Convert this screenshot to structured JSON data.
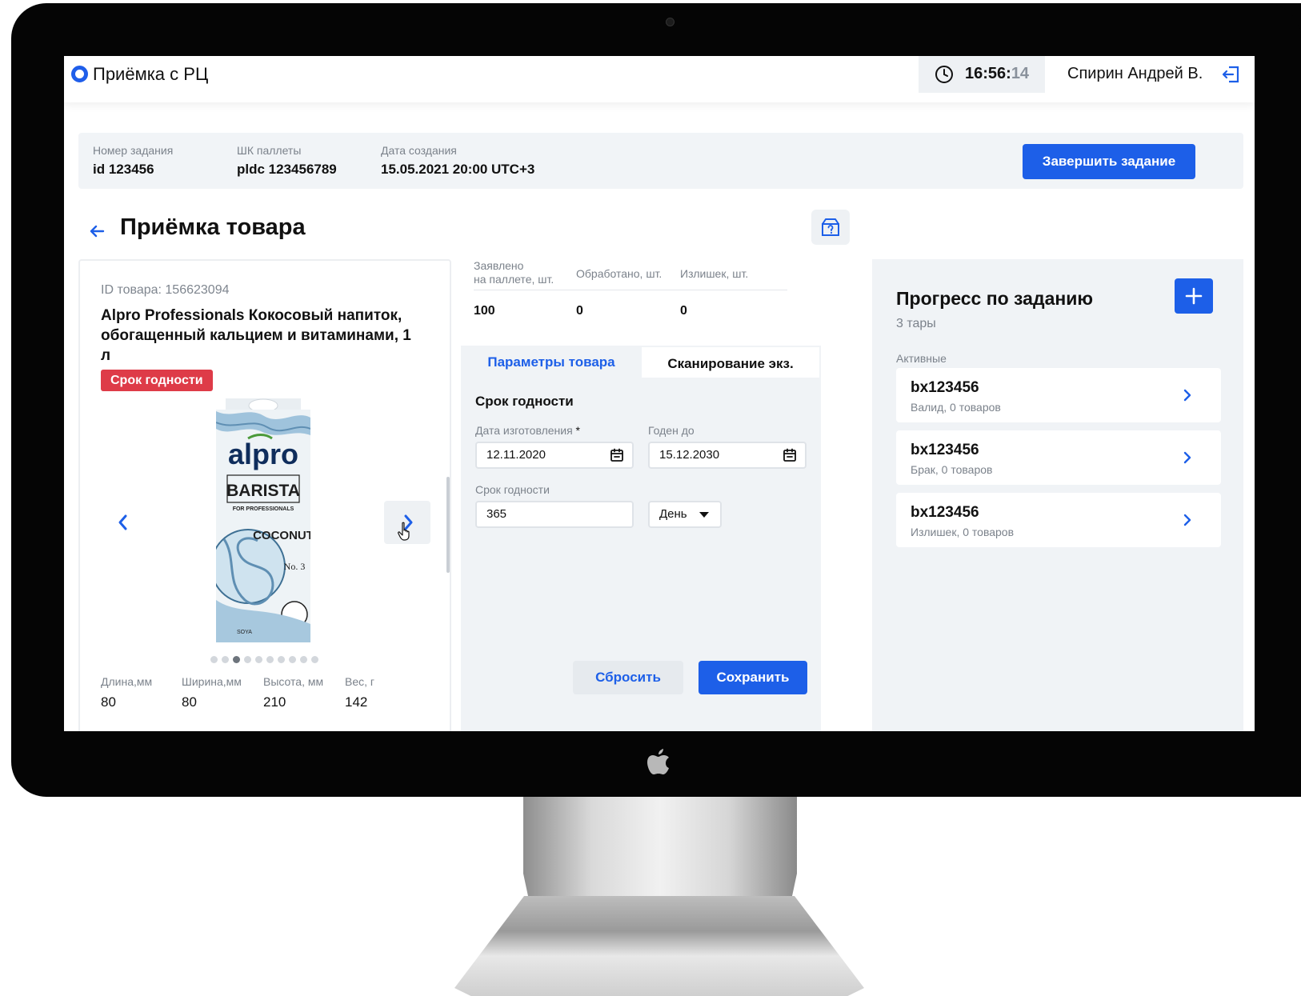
{
  "header": {
    "app_title": "Приёмка с РЦ",
    "clock_main": "16:56:",
    "clock_seconds": "14",
    "user_name": "Спирин Андрей В."
  },
  "task": {
    "number_label": "Номер задания",
    "number_value": "id 123456",
    "pallet_label": "ШК паллеты",
    "pallet_value": "pldc 123456789",
    "created_label": "Дата создания",
    "created_value": "15.05.2021 20:00 UTC+3",
    "finish_button": "Завершить задание"
  },
  "page": {
    "title": "Приёмка товара"
  },
  "product": {
    "id_text": "ID товара: 156623094",
    "name": "Alpro Professionals Кокосовый напиток, обогащенный кальцием и витаминами, 1 л",
    "badge": "Срок годности",
    "carousel_total": 10,
    "carousel_active_index": 3,
    "dimensions": [
      {
        "label": "Длина,мм",
        "value": "80"
      },
      {
        "label": "Ширина,мм",
        "value": "80"
      },
      {
        "label": "Высота, мм",
        "value": "210"
      },
      {
        "label": "Вес, г",
        "value": "142"
      }
    ]
  },
  "stats": {
    "declared_label_1": "Заявлено",
    "declared_label_2": "на паллете, шт.",
    "processed_label": "Обработано, шт.",
    "surplus_label": "Излишек, шт.",
    "declared_value": "100",
    "processed_value": "0",
    "surplus_value": "0"
  },
  "form": {
    "tab_params": "Параметры товара",
    "tab_scan": "Сканирование экз.",
    "section_title": "Срок годности",
    "manufacture_label": "Дата изготовления",
    "required_mark": "*",
    "manufacture_value": "12.11.2020",
    "expiry_label": "Годен до",
    "expiry_value": "15.12.2030",
    "shelf_life_label": "Срок годности",
    "shelf_life_value": "365",
    "unit_value": "День",
    "reset_button": "Сбросить",
    "save_button": "Сохранить"
  },
  "progress": {
    "title": "Прогресс по заданию",
    "subtitle": "3 тары",
    "section_label": "Активные",
    "boxes": [
      {
        "id": "bx123456",
        "meta": "Валид, 0 товаров"
      },
      {
        "id": "bx123456",
        "meta": "Брак, 0 товаров"
      },
      {
        "id": "bx123456",
        "meta": "Излишек, 0 товаров"
      }
    ]
  },
  "colors": {
    "accent": "#1d5fe8",
    "danger": "#de3b48",
    "panel": "#f0f3f6"
  },
  "icons": [
    "clock-icon",
    "logout-icon",
    "back-arrow-icon",
    "box-question-icon",
    "calendar-icon",
    "chevron-left-icon",
    "chevron-right-icon",
    "plus-icon",
    "pointer-cursor-icon",
    "apple-logo"
  ]
}
